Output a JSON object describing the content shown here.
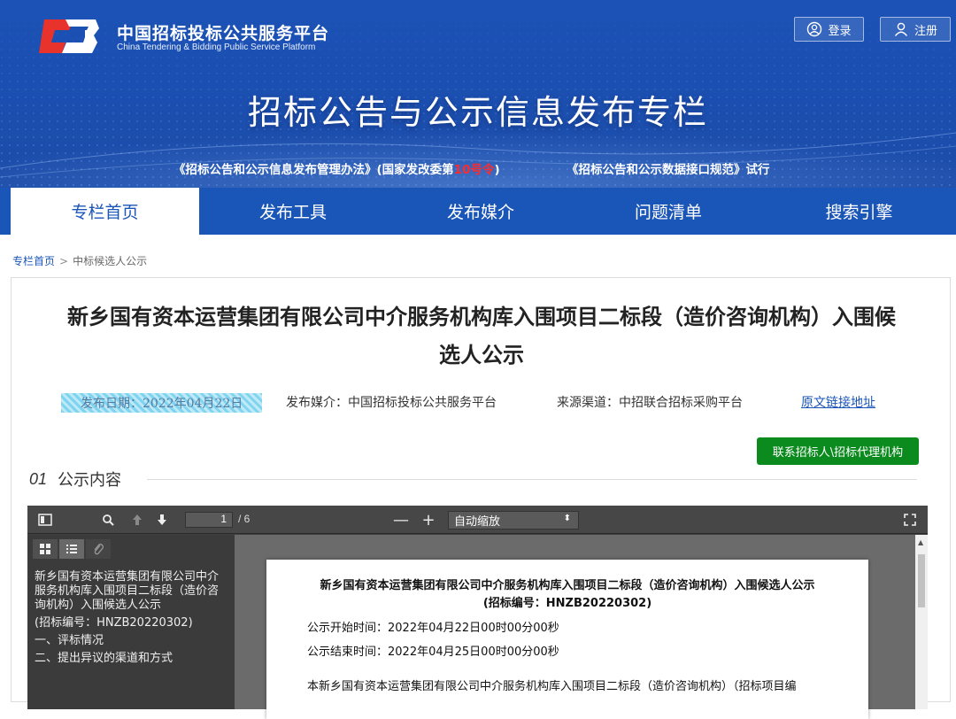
{
  "header": {
    "brand_cn": "中国招标投标公共服务平台",
    "brand_en": "China Tendering & Bidding Public Service Platform",
    "login": "登录",
    "register": "注册",
    "banner_title": "招标公告与公示信息发布专栏",
    "notice_1_pre": "《招标公告和公示信息发布管理办法》(国家发改委第",
    "notice_1_red": "10号令",
    "notice_1_post": ")",
    "notice_2": "《招标公告和公示数据接口规范》试行",
    "brand_color": "#1a56b7"
  },
  "nav": {
    "items": [
      "专栏首页",
      "发布工具",
      "发布媒介",
      "问题清单",
      "搜索引擎"
    ],
    "active_index": 0
  },
  "breadcrumb": {
    "home": "专栏首页",
    "separator": ">",
    "current": "中标候选人公示"
  },
  "article": {
    "title_line1": "新乡国有资本运营集团有限公司中介服务机构库入围项目二标段（造价咨询机构）入围候",
    "title_line2": "选人公示",
    "date": "发布日期：2022年04月22日",
    "media": "发布媒介：中国招标投标公共服务平台",
    "source": "来源渠道：中招联合招标采购平台",
    "original_link": "原文链接地址",
    "contact_button": "联系招标人\\招标代理机构",
    "section_num": "01",
    "section_label": "公示内容",
    "contact_color": "#0b8a1e"
  },
  "viewer": {
    "page_current": "1",
    "page_total": "/ 6",
    "zoom": "自动缩放",
    "outline": [
      "新乡国有资本运营集团有限公司中介服务机构库入围项目二标段（造价咨询机构）入围候选人公示",
      "(招标编号：HNZB20220302)",
      "一、评标情况",
      "二、提出异议的渠道和方式"
    ],
    "page": {
      "title": "新乡国有资本运营集团有限公司中介服务机构库入围项目二标段（造价咨询机构）入围候选人公示",
      "subtitle": "(招标编号：HNZB20220302)",
      "start": "公示开始时间：2022年04月22日00时00分00秒",
      "end": "公示结束时间：2022年04月25日00时00分00秒",
      "body": "本新乡国有资本运营集团有限公司中介服务机构库入围项目二标段（造价咨询机构）（招标项目编"
    }
  }
}
